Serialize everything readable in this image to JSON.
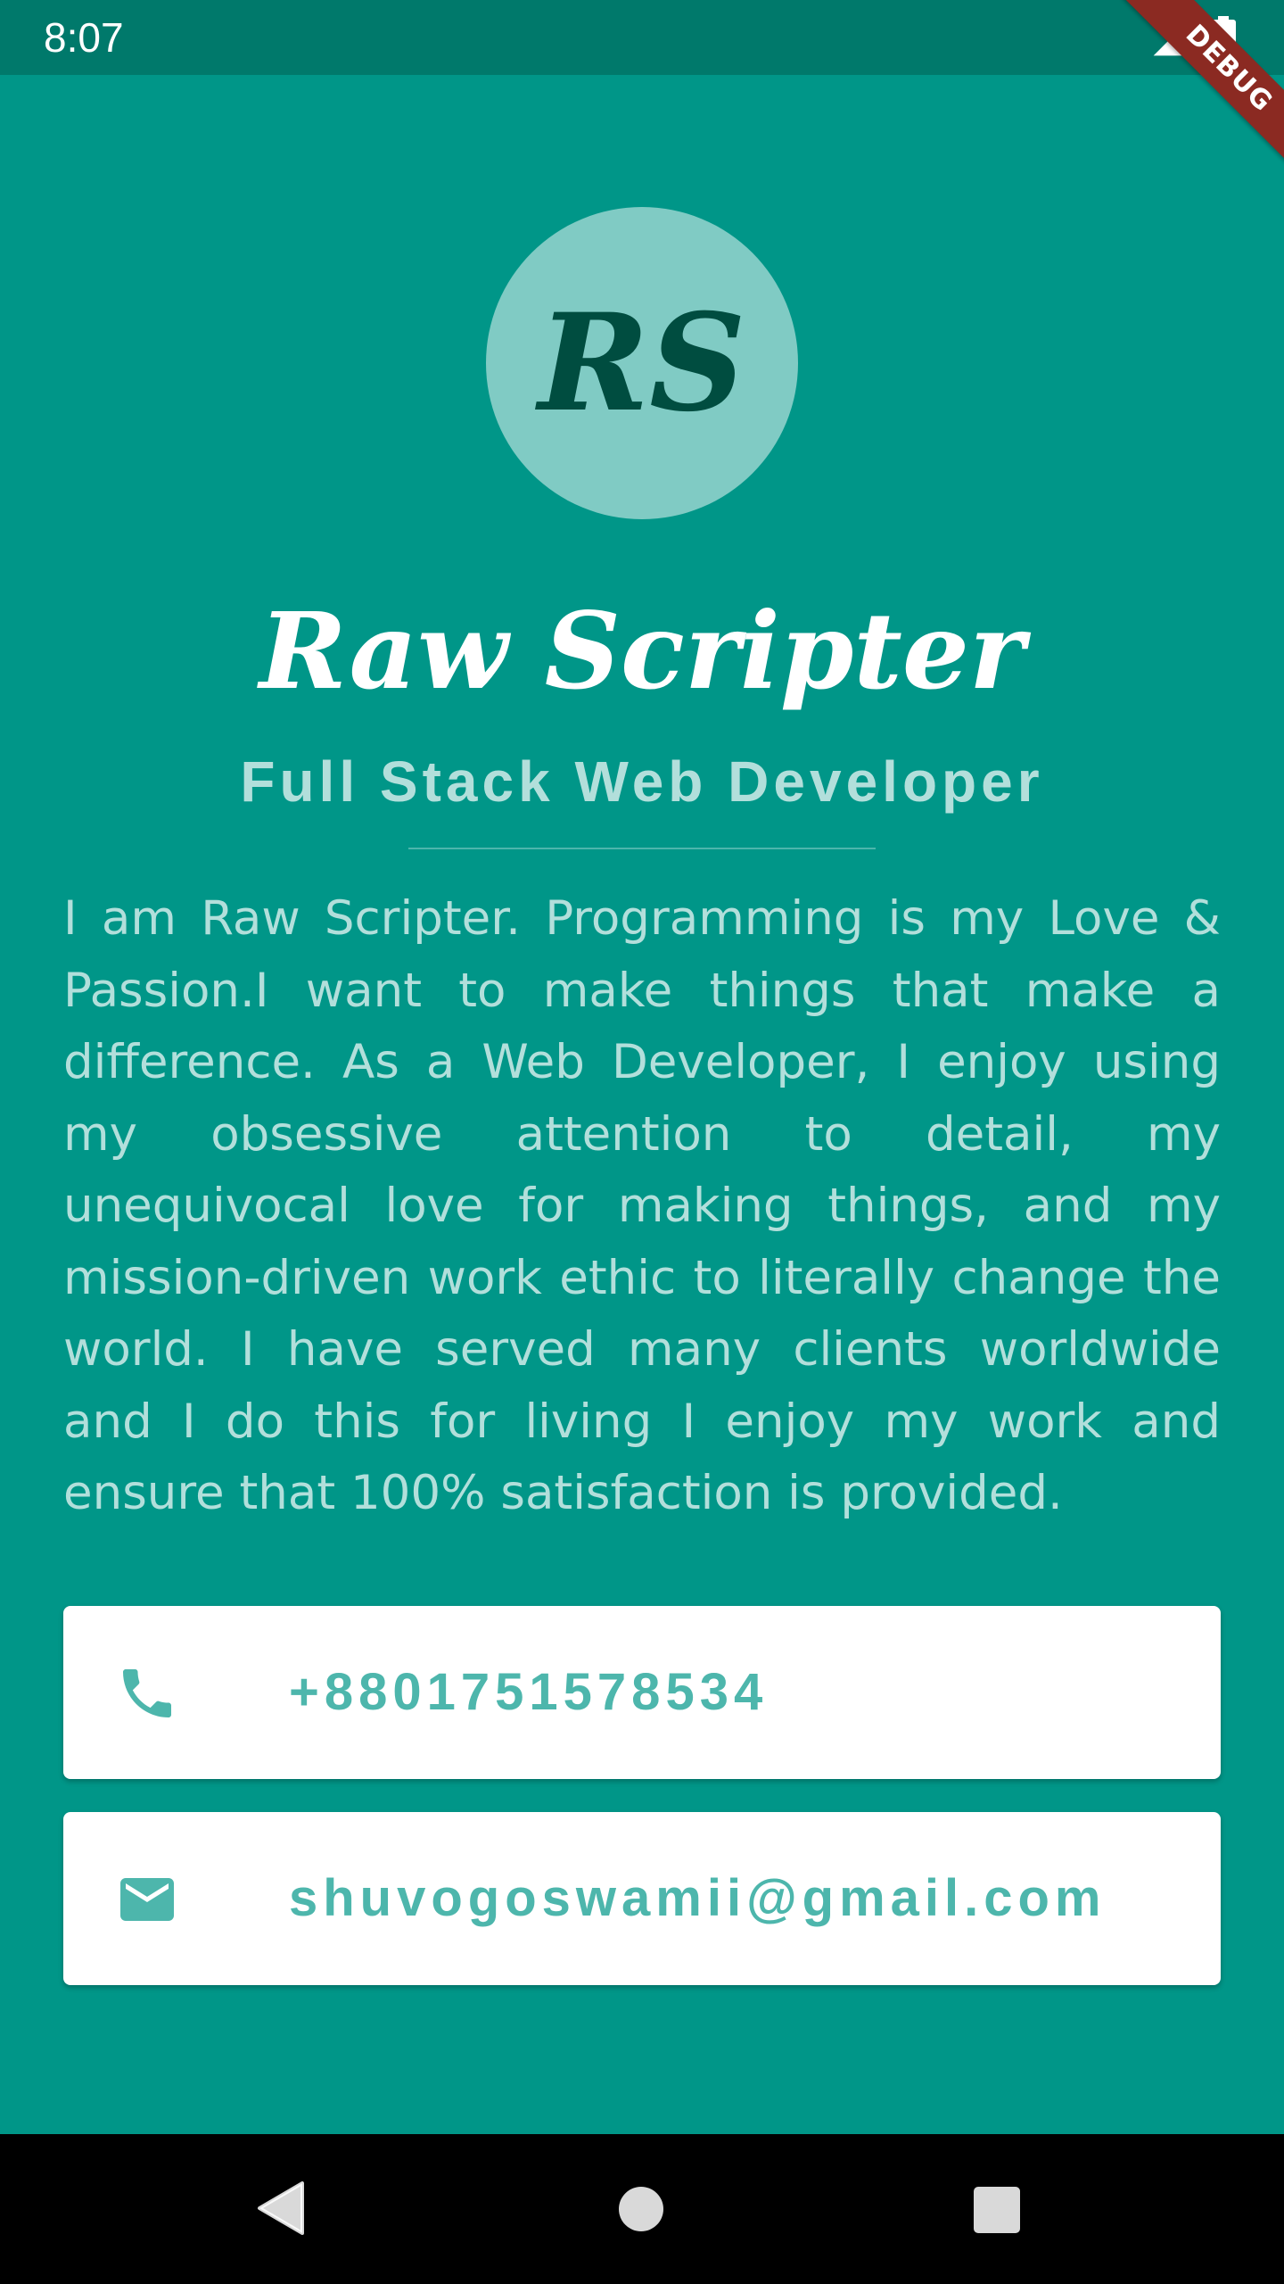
{
  "status_bar": {
    "time": "8:07"
  },
  "debug_banner": "DEBUG",
  "profile": {
    "initials": "RS",
    "name": "Raw Scripter",
    "title": "Full Stack Web Developer",
    "bio": "I am Raw Scripter. Programming is my Love & Passion.I want to make things that make a difference. As a Web Developer, I enjoy using my obsessive attention to detail, my unequivocal love for making things, and my mission-driven work ethic to literally change the world. I have served many clients worldwide and I do this for living I enjoy my work and ensure that 100% satisfaction is provided."
  },
  "contacts": {
    "phone": {
      "icon": "phone-icon",
      "value": "+8801751578534"
    },
    "email": {
      "icon": "email-icon",
      "value": "shuvogoswamii@gmail.com"
    }
  },
  "nav": {
    "back_icon": "back-triangle-icon",
    "home_icon": "home-circle-icon",
    "recents_icon": "recents-square-icon"
  },
  "colors": {
    "background": "#009688",
    "status_bar": "#00796b",
    "avatar_bg": "#80cbc4",
    "avatar_text": "#004d40",
    "accent_text": "#b2dfdb",
    "card_text": "#4db6ac",
    "debug_ribbon": "#8b2a22"
  }
}
